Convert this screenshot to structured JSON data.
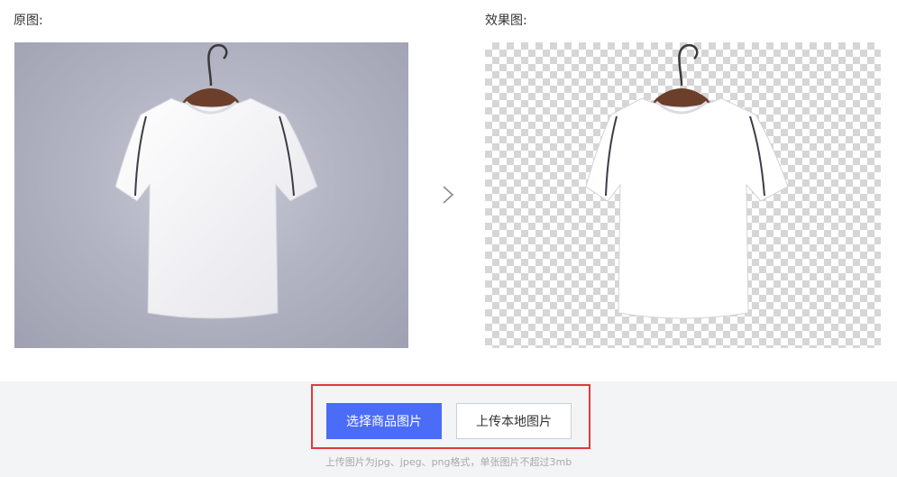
{
  "original_label": "原图:",
  "result_label": "效果图:",
  "arrow_icon": "chevron-right-icon",
  "buttons": {
    "select_product_image": "选择商品图片",
    "upload_local_image": "上传本地图片"
  },
  "hint": "上传图片为jpg、jpeg、png格式，单张图片不超过3mb",
  "colors": {
    "primary": "#4a6cf7",
    "highlight_border": "#e0393e",
    "bottom_bar": "#f3f4f6"
  }
}
